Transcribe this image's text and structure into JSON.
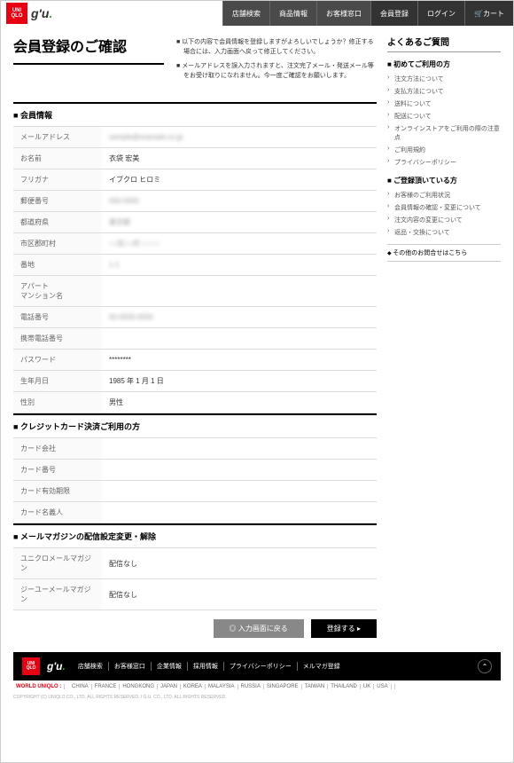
{
  "header": {
    "nav": [
      "店舗検索",
      "商品情報",
      "お客様窓口",
      "会員登録",
      "ログイン",
      "カート"
    ]
  },
  "page": {
    "title": "会員登録のご確認",
    "notes": [
      "以下の内容で会員情報を登録しますがよろしいでしょうか？修正する場合には、入力画面へ戻って修正してください。",
      "メールアドレスを誤入力されますと、注文完了メール・発送メール等をお受け取りになれません。今一度ご確認をお願いします。"
    ]
  },
  "sections": {
    "member": {
      "title": "会員情報",
      "rows": [
        {
          "label": "メールアドレス",
          "value": "sample@example.co.jp",
          "blur": true
        },
        {
          "label": "お名前",
          "value": "衣袋 宏美"
        },
        {
          "label": "フリガナ",
          "value": "イブクロ ヒロミ"
        },
        {
          "label": "郵便番号",
          "value": "000-0000",
          "blur": true
        },
        {
          "label": "都道府県",
          "value": "東京都",
          "blur": true
        },
        {
          "label": "市区郡町村",
          "value": "○○区○○町 ○-○-○",
          "blur": true
        },
        {
          "label": "番地",
          "value": "1-1",
          "blur": true
        },
        {
          "label": "アパート\nマンション名",
          "value": ""
        },
        {
          "label": "電話番号",
          "value": "00-0000-0000",
          "blur": true
        },
        {
          "label": "携帯電話番号",
          "value": ""
        },
        {
          "label": "パスワード",
          "value": "********"
        },
        {
          "label": "生年月日",
          "value": "1985 年 1 月 1 日"
        },
        {
          "label": "性別",
          "value": "男性"
        }
      ]
    },
    "credit": {
      "title": "クレジットカード決済ご利用の方",
      "rows": [
        {
          "label": "カード会社",
          "value": ""
        },
        {
          "label": "カード番号",
          "value": ""
        },
        {
          "label": "カード有効期限",
          "value": ""
        },
        {
          "label": "カード名義人",
          "value": ""
        }
      ]
    },
    "mail": {
      "title": "メールマガジンの配信設定変更・解除",
      "rows": [
        {
          "label": "ユニクロメールマガジン",
          "value": "配信なし"
        },
        {
          "label": "ジーユーメールマガジン",
          "value": "配信なし"
        }
      ]
    }
  },
  "buttons": {
    "back": "◎ 入力画面に戻る",
    "submit": "登録する ▸"
  },
  "sidebar": {
    "title": "よくあるご質問",
    "groups": [
      {
        "sub": "初めてご利用の方",
        "items": [
          "注文方法について",
          "支払方法について",
          "送料について",
          "配送について",
          "オンラインストアをご利用の際の注意点",
          "ご利用規約",
          "プライバシーポリシー"
        ]
      },
      {
        "sub": "ご登録頂いている方",
        "items": [
          "お客様のご利用状況",
          "会員情報の確認・変更について",
          "注文内容の変更について",
          "返品・交換について"
        ]
      }
    ],
    "other": "その他のお問合せはこちら"
  },
  "footer": {
    "links": [
      "店舗検索",
      "お客様窓口",
      "企業情報",
      "採用情報",
      "プライバシーポリシー",
      "メルマガ登録"
    ],
    "world_label": "WORLD UNIQLO :",
    "countries": [
      "CHINA",
      "FRANCE",
      "HONGKONG",
      "JAPAN",
      "KOREA",
      "MALAYSIA",
      "RUSSIA",
      "SINGAPORE",
      "TAIWAN",
      "THAILAND",
      "UK",
      "USA"
    ],
    "copyright": "COPYRIGHT (C) UNIQLO CO., LTD. ALL RIGHTS RESERVED. / G.U. CO., LTD. ALL RIGHTS RESERVED."
  }
}
